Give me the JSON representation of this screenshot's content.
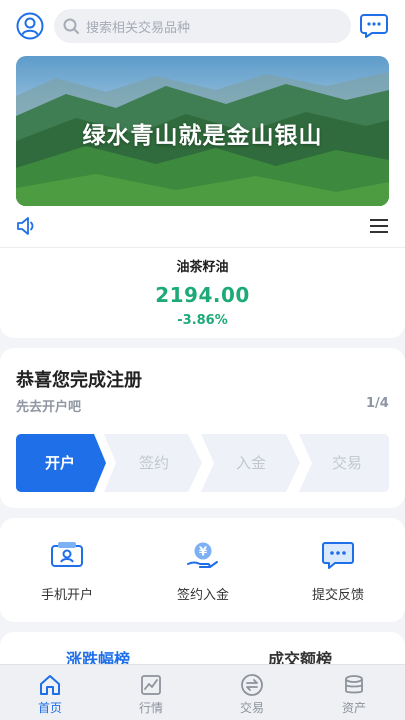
{
  "header": {
    "search_placeholder": "搜索相关交易品种",
    "avatar_icon": "user-avatar-icon",
    "message_icon": "message-chat-icon"
  },
  "banner": {
    "text": "绿水青山就是金山银山"
  },
  "ticker": {
    "name": "油茶籽油",
    "price": "2194.00",
    "change": "-3.86%",
    "color": "#1eaa77"
  },
  "registration": {
    "title": "恭喜您完成注册",
    "subtitle": "先去开户吧",
    "page": "1/4",
    "steps": [
      {
        "label": "开户",
        "active": true
      },
      {
        "label": "签约",
        "active": false
      },
      {
        "label": "入金",
        "active": false
      },
      {
        "label": "交易",
        "active": false
      }
    ],
    "accent": "#1f6fe8"
  },
  "quick_actions": [
    {
      "label": "手机开户",
      "icon": "id-card-icon"
    },
    {
      "label": "签约入金",
      "icon": "yen-hand-icon"
    },
    {
      "label": "提交反馈",
      "icon": "chat-feedback-icon"
    }
  ],
  "rankings": {
    "tabs": [
      "涨跌幅榜",
      "成交额榜"
    ]
  },
  "bottom_nav": [
    {
      "label": "首页",
      "icon": "home-icon",
      "active": true
    },
    {
      "label": "行情",
      "icon": "chart-icon",
      "active": false
    },
    {
      "label": "交易",
      "icon": "exchange-icon",
      "active": false
    },
    {
      "label": "资产",
      "icon": "coins-icon",
      "active": false
    }
  ]
}
